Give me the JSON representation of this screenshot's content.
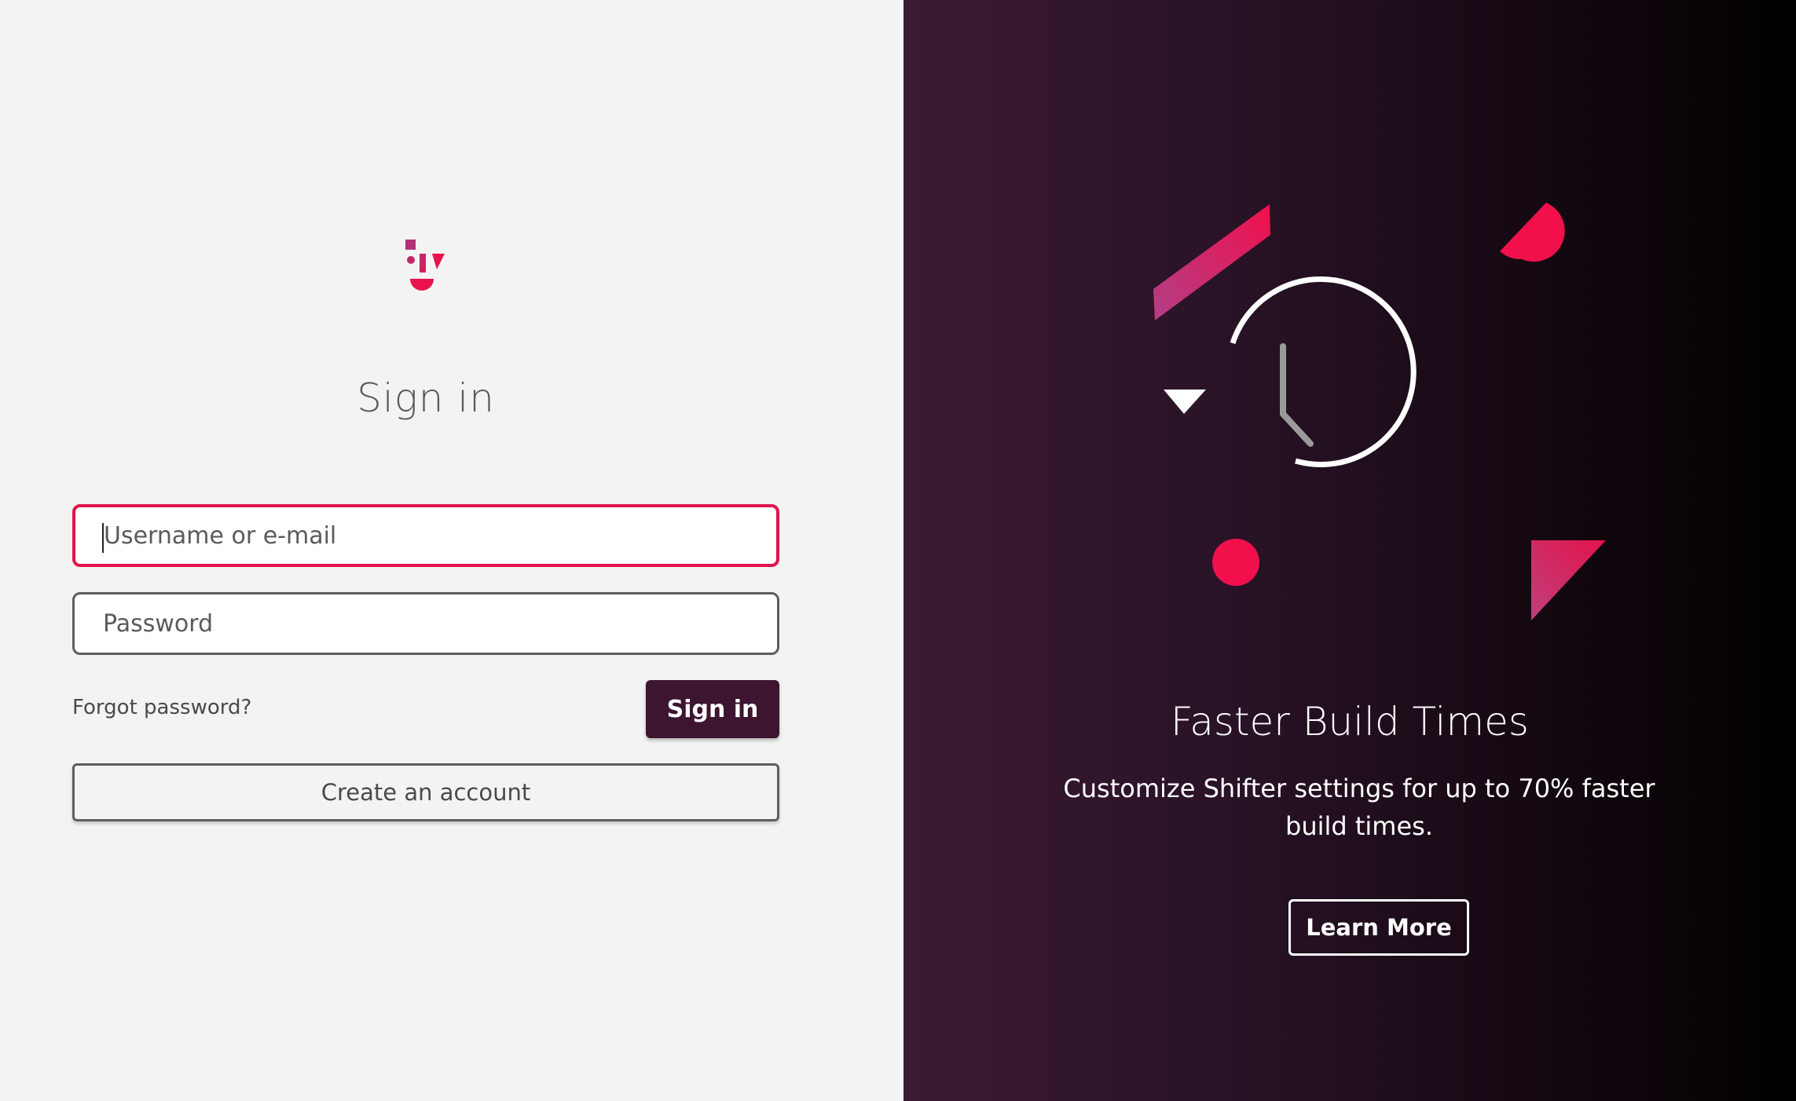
{
  "signin": {
    "title": "Sign in",
    "username_placeholder": "Username or e-mail",
    "password_placeholder": "Password",
    "forgot_label": "Forgot password?",
    "submit_label": "Sign in",
    "create_account_label": "Create an account"
  },
  "promo": {
    "title": "Faster Build Times",
    "description": "Customize Shifter settings for up to 70% faster build times.",
    "cta_label": "Learn More",
    "icon": "clock-history-icon"
  },
  "colors": {
    "accent": "#e0144c",
    "brand_dark": "#3d1530",
    "left_bg": "#f3f3f3",
    "right_bg_start": "#3b1932",
    "right_bg_end": "#000000"
  }
}
